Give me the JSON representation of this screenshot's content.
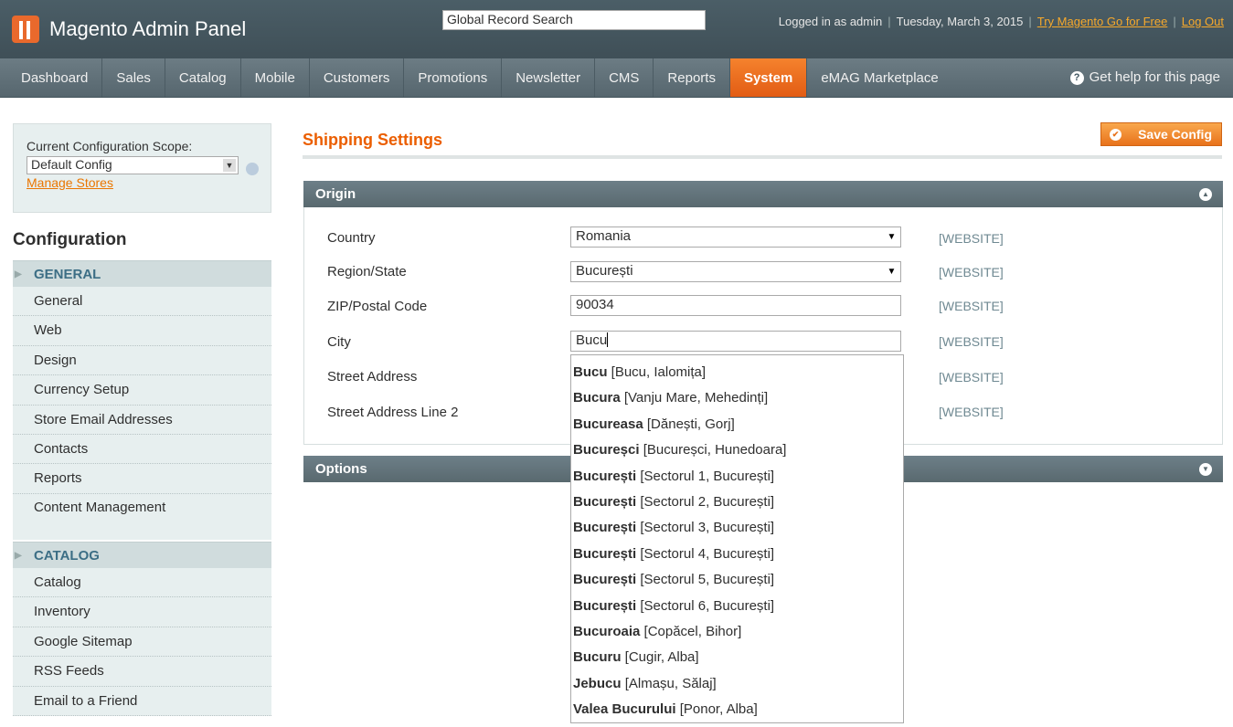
{
  "header": {
    "logo_text": "Magento Admin Panel",
    "search_value": "Global Record Search",
    "logged_in": "Logged in as admin",
    "date": "Tuesday, March 3, 2015",
    "try_link": "Try Magento Go for Free",
    "logout": "Log Out",
    "accent_color": "#e9692c"
  },
  "nav": {
    "items": [
      "Dashboard",
      "Sales",
      "Catalog",
      "Mobile",
      "Customers",
      "Promotions",
      "Newsletter",
      "CMS",
      "Reports",
      "System",
      "eMAG Marketplace"
    ],
    "active": "System",
    "help": "Get help for this page"
  },
  "sidebar": {
    "scope_label": "Current Configuration Scope:",
    "scope_value": "Default Config",
    "manage_stores": "Manage Stores",
    "config_title": "Configuration",
    "general_title": "GENERAL",
    "general_items": [
      "General",
      "Web",
      "Design",
      "Currency Setup",
      "Store Email Addresses",
      "Contacts",
      "Reports",
      "Content Management"
    ],
    "catalog_title": "CATALOG",
    "catalog_items": [
      "Catalog",
      "Inventory",
      "Google Sitemap",
      "RSS Feeds",
      "Email to a Friend"
    ]
  },
  "main": {
    "title": "Shipping Settings",
    "save_label": "Save Config",
    "origin_title": "Origin",
    "options_title": "Options",
    "fields": [
      {
        "label": "Country",
        "value": "Romania",
        "scope": "[WEBSITE]"
      },
      {
        "label": "Region/State",
        "value": "București",
        "scope": "[WEBSITE]"
      },
      {
        "label": "ZIP/Postal Code",
        "value": "90034",
        "scope": "[WEBSITE]"
      },
      {
        "label": "City",
        "value": "Bucu",
        "scope": "[WEBSITE]"
      },
      {
        "label": "Street Address",
        "value": "",
        "scope": "[WEBSITE]"
      },
      {
        "label": "Street Address Line 2",
        "value": "",
        "scope": "[WEBSITE]"
      }
    ]
  },
  "autocomplete": [
    {
      "name": "Bucu",
      "detail": "[Bucu, Ialomița]"
    },
    {
      "name": "Bucura",
      "detail": "[Vanju Mare, Mehedinți]"
    },
    {
      "name": "Bucureasa",
      "detail": "[Dănești, Gorj]"
    },
    {
      "name": "Bucureșci",
      "detail": "[Bucureșci, Hunedoara]"
    },
    {
      "name": "București",
      "detail": "[Sectorul 1, București]"
    },
    {
      "name": "București",
      "detail": "[Sectorul 2, București]"
    },
    {
      "name": "București",
      "detail": "[Sectorul 3, București]"
    },
    {
      "name": "București",
      "detail": "[Sectorul 4, București]"
    },
    {
      "name": "București",
      "detail": "[Sectorul 5, București]"
    },
    {
      "name": "București",
      "detail": "[Sectorul 6, București]"
    },
    {
      "name": "Bucuroaia",
      "detail": "[Copăcel, Bihor]"
    },
    {
      "name": "Bucuru",
      "detail": "[Cugir, Alba]"
    },
    {
      "name": "Jebucu",
      "detail": "[Almașu, Sălaj]"
    },
    {
      "name": "Valea Bucurului",
      "detail": "[Ponor, Alba]"
    }
  ]
}
